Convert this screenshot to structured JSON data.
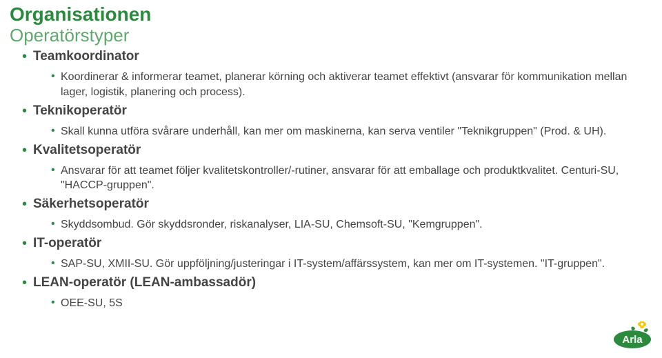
{
  "title": "Organisationen",
  "subtitle": "Operatörstyper",
  "roles": [
    {
      "name": "Teamkoordinator",
      "desc": "Koordinerar & informerar teamet, planerar körning och aktiverar teamet effektivt (ansvarar för kommunikation mellan lager, logistik, planering och process)."
    },
    {
      "name": "Teknikoperatör",
      "desc": "Skall kunna utföra svårare underhåll, kan mer om maskinerna, kan serva ventiler \"Teknikgruppen\" (Prod. & UH)."
    },
    {
      "name": "Kvalitetsoperatör",
      "desc": "Ansvarar för att teamet följer kvalitetskontroller/-rutiner, ansvarar för att emballage och produktkvalitet. Centuri-SU, \"HACCP-gruppen\"."
    },
    {
      "name": "Säkerhetsoperatör",
      "desc": "Skyddsombud. Gör skyddsronder, riskanalyser, LIA-SU, Chemsoft-SU, \"Kemgruppen\"."
    },
    {
      "name": "IT-operatör",
      "desc": "SAP-SU, XMII-SU. Gör uppföljning/justeringar i IT-system/affärssystem, kan mer om IT-systemen. \"IT-gruppen\"."
    },
    {
      "name": "LEAN-operatör (LEAN-ambassadör)",
      "desc": "OEE-SU, 5S"
    }
  ],
  "brand": {
    "name": "Arla",
    "green": "#2B8A3E",
    "yellow": "#F7C600",
    "white": "#FFFFFF"
  }
}
